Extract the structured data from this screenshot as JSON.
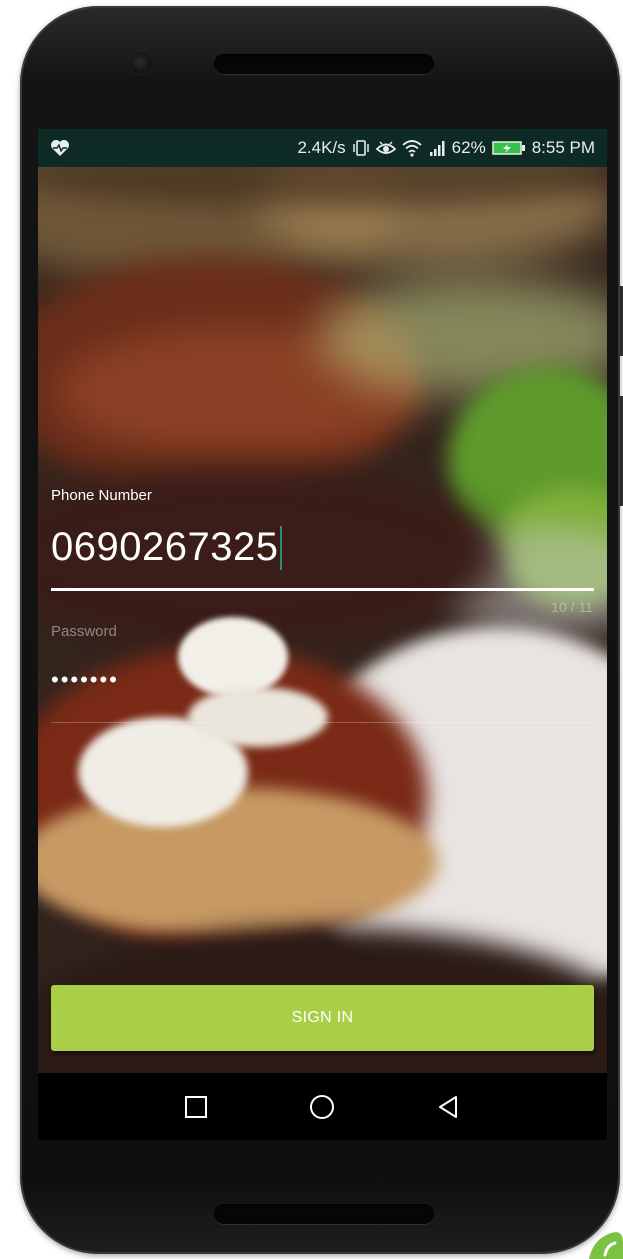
{
  "status_bar": {
    "network_speed": "2.4K/s",
    "battery_percent": "62%",
    "time": "8:55 PM",
    "icons": [
      "heart-pulse-icon",
      "vibrate-icon",
      "eye-icon",
      "wifi-icon",
      "signal-icon",
      "battery-charging-icon"
    ]
  },
  "login": {
    "phone_label": "Phone Number",
    "phone_value": "0690267325",
    "phone_counter": "10 / 11",
    "password_label": "Password",
    "password_value": "•••••••",
    "sign_in_label": "SIGN IN"
  },
  "nav_bar": {
    "icons": [
      "recent-apps-icon",
      "home-icon",
      "back-icon"
    ]
  },
  "colors": {
    "status_bar_bg": "#0d2a25",
    "button_bg": "#a8cf45",
    "caret": "#2e8b78",
    "nav_bar_bg": "#000000"
  }
}
